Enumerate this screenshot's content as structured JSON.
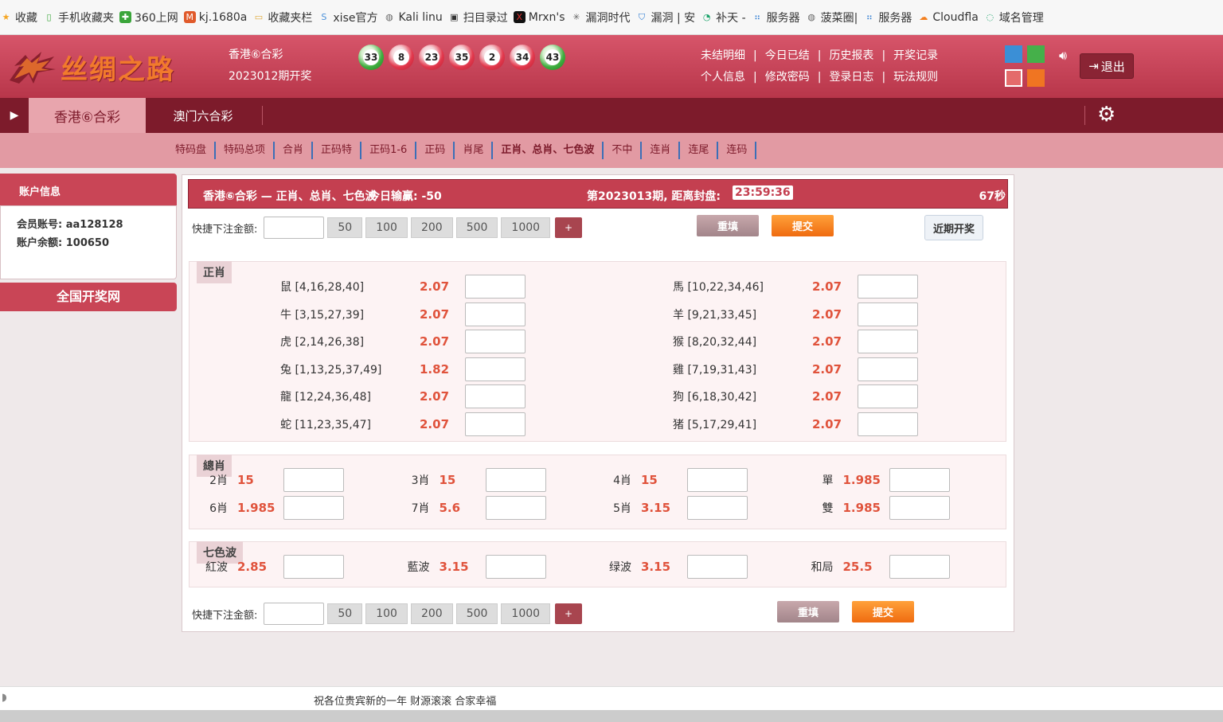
{
  "bookmarks": [
    {
      "label": "收藏",
      "icon": "star-icon"
    },
    {
      "label": "手机收藏夹",
      "icon": "phone-icon"
    },
    {
      "label": "360上网",
      "icon": "360-icon"
    },
    {
      "label": "kj.1680a",
      "icon": "site-icon"
    },
    {
      "label": "收藏夹栏",
      "icon": "folder-icon"
    },
    {
      "label": "xise官方",
      "icon": "s-icon"
    },
    {
      "label": "Kali linu",
      "icon": "globe-icon"
    },
    {
      "label": "扫目录过",
      "icon": "scan-icon"
    },
    {
      "label": "Mrxn's",
      "icon": "mrxn-icon"
    },
    {
      "label": "漏洞时代",
      "icon": "bug-icon"
    },
    {
      "label": "漏洞 | 安",
      "icon": "shield-icon"
    },
    {
      "label": "补天 -",
      "icon": "butian-icon"
    },
    {
      "label": "服务器",
      "icon": "server-icon"
    },
    {
      "label": "菠菜圈|",
      "icon": "globe-icon"
    },
    {
      "label": "服务器",
      "icon": "server-icon"
    },
    {
      "label": "Cloudfla",
      "icon": "cloud-icon"
    },
    {
      "label": "域名管理",
      "icon": "domain-icon"
    }
  ],
  "header": {
    "logo_text": "丝绸之路",
    "game_name": "香港⑥合彩",
    "draw_label": "2023012期开奖",
    "balls": [
      {
        "n": "33",
        "color": "green"
      },
      {
        "n": "8",
        "color": "red"
      },
      {
        "n": "23",
        "color": "red"
      },
      {
        "n": "35",
        "color": "red"
      },
      {
        "n": "2",
        "color": "red"
      },
      {
        "n": "34",
        "color": "red"
      },
      {
        "n": "43",
        "color": "green"
      }
    ],
    "links_row1": [
      "未结明细",
      "今日已结",
      "历史报表",
      "开奖记录"
    ],
    "links_row2": [
      "个人信息",
      "修改密码",
      "登录日志",
      "玩法规则"
    ],
    "logout": "退出",
    "swatch_colors": [
      "#3b8fd6",
      "#45b04a",
      "#e46b6b",
      "#f07522"
    ]
  },
  "nav": {
    "tabs": [
      "香港⑥合彩",
      "澳门六合彩"
    ]
  },
  "subnav": [
    "特码盘",
    "特码总项",
    "合肖",
    "正码特",
    "正码1-6",
    "正码",
    "肖尾",
    "正肖、总肖、七色波",
    "不中",
    "连肖",
    "连尾",
    "连码"
  ],
  "account": {
    "title": "账户信息",
    "member_label": "会员账号:",
    "member": "aa128128",
    "balance_label": "账户余额:",
    "balance": "100650",
    "kaijiang": "全国开奖网"
  },
  "panel": {
    "title": "香港⑥合彩 — 正肖、总肖、七色波",
    "winloss": "今日输赢: -50",
    "period": "第2023013期, 距离封盘:",
    "countdown": "23:59:36",
    "refresh": "67秒",
    "quick_label": "快捷下注金额:",
    "quick_amounts": [
      "50",
      "100",
      "200",
      "500",
      "1000"
    ],
    "plus": "+",
    "reset": "重填",
    "submit": "提交",
    "recent": "近期开奖"
  },
  "zhengxiao": {
    "title": "正肖",
    "left": [
      {
        "name": "鼠 [4,16,28,40]",
        "odds": "2.07"
      },
      {
        "name": "牛 [3,15,27,39]",
        "odds": "2.07"
      },
      {
        "name": "虎 [2,14,26,38]",
        "odds": "2.07"
      },
      {
        "name": "兔 [1,13,25,37,49]",
        "odds": "1.82"
      },
      {
        "name": "龍 [12,24,36,48]",
        "odds": "2.07"
      },
      {
        "name": "蛇 [11,23,35,47]",
        "odds": "2.07"
      }
    ],
    "right": [
      {
        "name": "馬 [10,22,34,46]",
        "odds": "2.07"
      },
      {
        "name": "羊 [9,21,33,45]",
        "odds": "2.07"
      },
      {
        "name": "猴 [8,20,32,44]",
        "odds": "2.07"
      },
      {
        "name": "雞 [7,19,31,43]",
        "odds": "2.07"
      },
      {
        "name": "狗 [6,18,30,42]",
        "odds": "2.07"
      },
      {
        "name": "猪 [5,17,29,41]",
        "odds": "2.07"
      }
    ]
  },
  "zongxiao": {
    "title": "總肖",
    "row1": [
      {
        "name": "2肖",
        "odds": "15"
      },
      {
        "name": "3肖",
        "odds": "15"
      },
      {
        "name": "4肖",
        "odds": "15"
      },
      {
        "name": "單",
        "odds": "1.985"
      }
    ],
    "row2": [
      {
        "name": "6肖",
        "odds": "1.985"
      },
      {
        "name": "7肖",
        "odds": "5.6"
      },
      {
        "name": "5肖",
        "odds": "3.15"
      },
      {
        "name": "雙",
        "odds": "1.985"
      }
    ]
  },
  "qisebo": {
    "title": "七色波",
    "row": [
      {
        "name": "紅波",
        "odds": "2.85"
      },
      {
        "name": "藍波",
        "odds": "3.15"
      },
      {
        "name": "绿波",
        "odds": "3.15"
      },
      {
        "name": "和局",
        "odds": "25.5"
      }
    ]
  },
  "footer": {
    "text": "祝各位贵宾新的一年 财源滚滚 合家幸福"
  }
}
